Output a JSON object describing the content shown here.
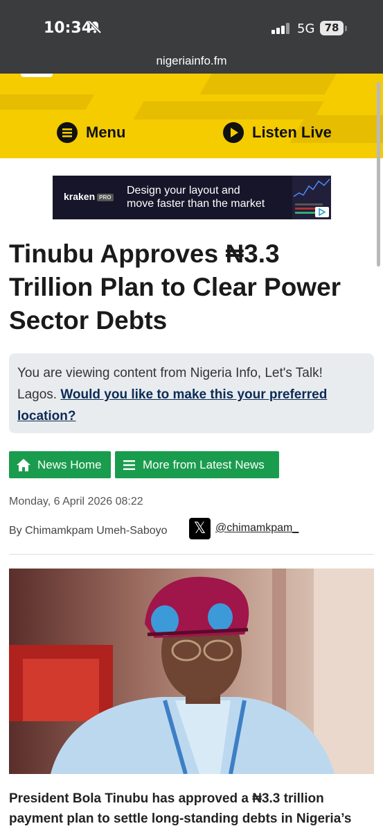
{
  "status_bar": {
    "time": "10:34",
    "network": "5G",
    "battery": "78"
  },
  "browser": {
    "url": "nigeriainfo.fm"
  },
  "header": {
    "menu_label": "Menu",
    "listen_label": "Listen Live"
  },
  "ad": {
    "brand": "kraken",
    "brand_badge": "PRO",
    "text": "Design your layout and move faster than the market"
  },
  "article": {
    "title": "Tinubu Approves ₦3.3 Trillion Plan to Clear Power Sector Debts",
    "notice_text": "You are viewing content from Nigeria Info, Let's Talk! Lagos. ",
    "notice_link": "Would you like to make this your preferred location?",
    "news_home_label": "News Home",
    "more_label": "More from Latest News",
    "date": "Monday, 6 April 2026 08:22",
    "byline": "By Chimamkpam Umeh-Saboyo",
    "twitter_handle": "@chimamkpam_",
    "body": "President Bola Tinubu has approved a ₦3.3 trillion payment plan to settle long-standing debts in Nigeria’s"
  },
  "colors": {
    "brand_yellow": "#f4cc00",
    "green_button": "#1a9c4e",
    "notice_bg": "#e9ecef"
  },
  "icons": [
    "bell-slash-icon",
    "signal-icon",
    "menu-icon",
    "play-icon",
    "home-icon",
    "list-icon",
    "x-logo-icon",
    "ad-choices-icon"
  ]
}
